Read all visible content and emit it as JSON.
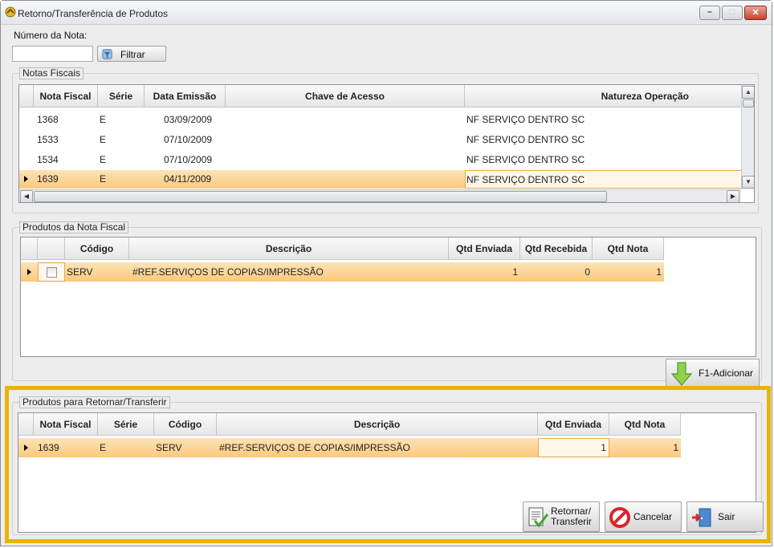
{
  "window": {
    "title": "Retorno/Transferência de Produtos"
  },
  "filter": {
    "label": "Número da Nota:",
    "value": "",
    "button": "Filtrar"
  },
  "notas": {
    "title": "Notas Fiscais",
    "columns": [
      "Nota Fiscal",
      "Série",
      "Data Emissão",
      "Chave de Acesso",
      "Natureza Operação"
    ],
    "rows": [
      [
        "1368",
        "E",
        "03/09/2009",
        "",
        "NF SERVIÇO DENTRO SC"
      ],
      [
        "1533",
        "E",
        "07/10/2009",
        "",
        "NF SERVIÇO DENTRO SC"
      ],
      [
        "1534",
        "E",
        "07/10/2009",
        "",
        "NF SERVIÇO DENTRO SC"
      ],
      [
        "1639",
        "E",
        "04/11/2009",
        "",
        "NF SERVIÇO DENTRO SC"
      ]
    ]
  },
  "produtos": {
    "title": "Produtos da Nota Fiscal",
    "columns": [
      "",
      "Código",
      "Descrição",
      "Qtd Enviada",
      "Qtd Recebida",
      "Qtd Nota"
    ],
    "rows": [
      [
        "",
        "SERV",
        "#REF.SERVIÇOS DE COPIAS/IMPRESSÃO",
        "1",
        "0",
        "1"
      ]
    ],
    "add_button": "F1-Adicionar"
  },
  "retornar": {
    "title": "Produtos para Retornar/Transferir",
    "columns": [
      "Nota Fiscal",
      "Série",
      "Código",
      "Descrição",
      "Qtd Enviada",
      "Qtd Nota"
    ],
    "rows": [
      [
        "1639",
        "E",
        "SERV",
        "#REF.SERVIÇOS DE COPIAS/IMPRESSÃO",
        "1",
        "1"
      ]
    ]
  },
  "actions": {
    "retornar_line1": "Retornar/",
    "retornar_line2": "Transferir",
    "cancelar": "Cancelar",
    "sair": "Sair"
  },
  "colors": {
    "selection": "#fbc97c",
    "highlight": "#e8b400",
    "accent_green": "#7fc54a",
    "cancel_red": "#d8262c"
  },
  "icons": [
    "app-icon",
    "filter-icon",
    "add-arrow-icon",
    "retornar-icon",
    "cancel-icon",
    "exit-door-icon"
  ]
}
